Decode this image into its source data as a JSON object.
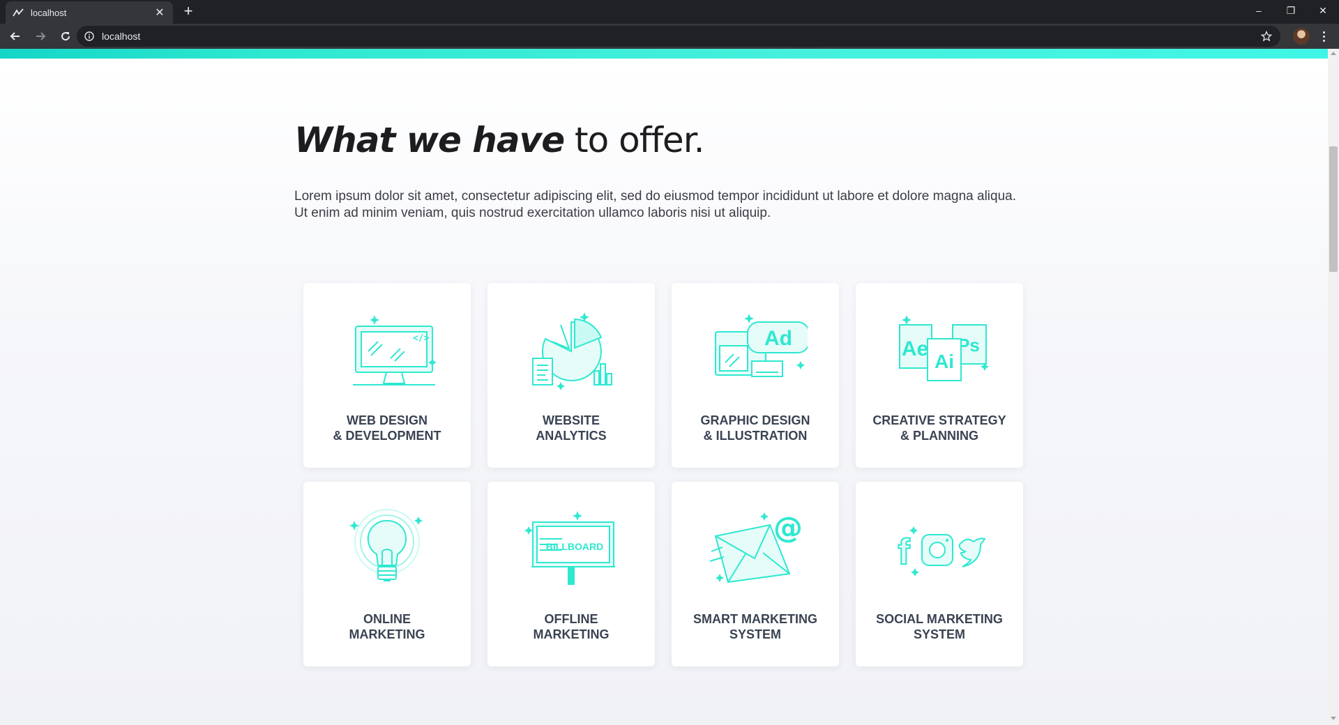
{
  "browser": {
    "tab_title": "localhost",
    "new_tab_symbol": "+",
    "close_symbol": "✕",
    "address": "localhost",
    "window_controls": {
      "minimize": "–",
      "restore": "❐",
      "close": "✕"
    }
  },
  "page": {
    "heading_bold": "What we have",
    "heading_light": " to offer.",
    "lead_text": "Lorem ipsum dolor sit amet, consectetur adipiscing elit, sed do eiusmod tempor incididunt ut labore et dolore magna aliqua. Ut enim ad minim veniam, quis nostrud exercitation ullamco laboris nisi ut aliquip."
  },
  "services": [
    {
      "line1": "WEB DESIGN",
      "line2": "& DEVELOPMENT",
      "icon": "monitor-code-icon"
    },
    {
      "line1": "WEBSITE",
      "line2": "ANALYTICS",
      "icon": "pie-chart-icon"
    },
    {
      "line1": "GRAPHIC DESIGN",
      "line2": "& ILLUSTRATION",
      "icon": "ad-design-icon",
      "icon_text": "Ad"
    },
    {
      "line1": "CREATIVE STRATEGY",
      "line2": "& PLANNING",
      "icon": "adobe-apps-icon",
      "icon_text": [
        "Ae",
        "Ai",
        "Ps"
      ]
    },
    {
      "line1": "ONLINE",
      "line2": "MARKETING",
      "icon": "lightbulb-icon"
    },
    {
      "line1": "OFFLINE",
      "line2": "MARKETING",
      "icon": "billboard-icon",
      "icon_text": "BILLBOARD"
    },
    {
      "line1": "SMART MARKETING",
      "line2": "SYSTEM",
      "icon": "email-icon",
      "icon_text": "@"
    },
    {
      "line1": "SOCIAL MARKETING",
      "line2": "SYSTEM",
      "icon": "social-icons-icon",
      "icon_text": "f"
    }
  ],
  "colors": {
    "accent": "#2ee8d0",
    "accent_light": "#c9fbf4",
    "heading": "#1d1d1f",
    "card_title": "#3a4352"
  }
}
